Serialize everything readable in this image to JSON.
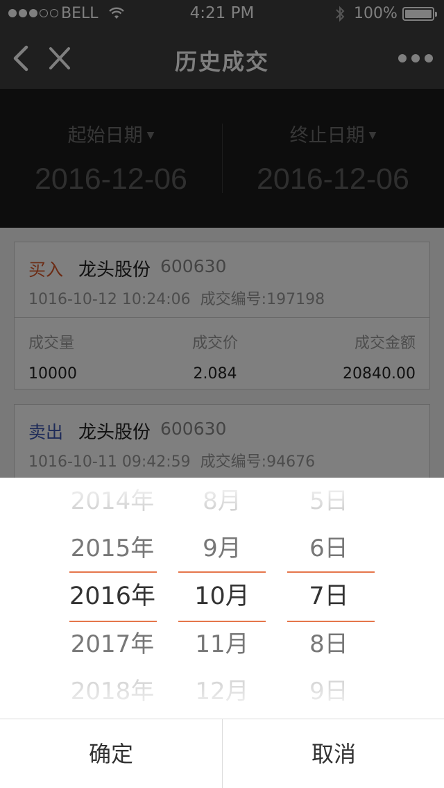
{
  "status_bar": {
    "carrier": "BELL",
    "time": "4:21 PM",
    "battery": "100%"
  },
  "nav": {
    "title": "历史成交"
  },
  "date_filter": {
    "start_label": "起始日期",
    "start_value": "2016-12-06",
    "end_label": "终止日期",
    "end_value": "2016-12-06"
  },
  "trades": [
    {
      "side": "买入",
      "name": "龙头股份",
      "code": "600630",
      "datetime": "1016-10-12 10:24:06",
      "trade_no_label": "成交编号:",
      "trade_no": "197198",
      "volume_label": "成交量",
      "volume": "10000",
      "price_label": "成交价",
      "price": "2.084",
      "amount_label": "成交金额",
      "amount": "20840.00"
    },
    {
      "side": "卖出",
      "name": "龙头股份",
      "code": "600630",
      "datetime": "1016-10-11 09:42:59",
      "trade_no_label": "成交编号:",
      "trade_no": "94676"
    }
  ],
  "picker": {
    "years": [
      "2014年",
      "2015年",
      "2016年",
      "2017年",
      "2018年"
    ],
    "months": [
      "8月",
      "9月",
      "10月",
      "11月",
      "12月"
    ],
    "days": [
      "5日",
      "6日",
      "7日",
      "8日",
      "9日"
    ],
    "selected": {
      "year": "2016年",
      "month": "10月",
      "day": "7日"
    },
    "accent_color": "#e5764b"
  },
  "actions": {
    "confirm": "确定",
    "cancel": "取消"
  },
  "colors": {
    "buy": "#d9582b",
    "sell": "#3a55b0",
    "header_bg": "#3e3e3e"
  }
}
